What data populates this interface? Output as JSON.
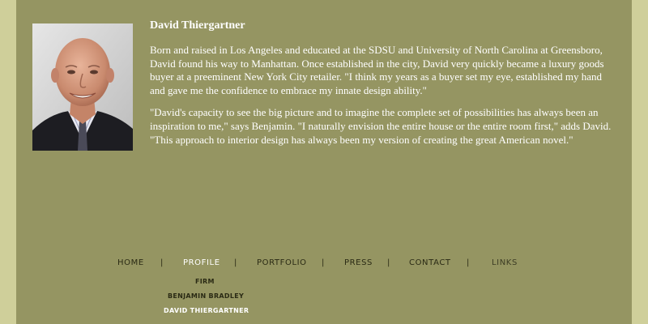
{
  "bio": {
    "name": "David Thiergartner",
    "paragraphs": [
      "Born and raised in Los Angeles and educated at the SDSU and University of North Carolina at Greensboro, David found his way to Manhattan. Once established in the city, David very quickly became a luxury goods buyer at a preeminent New York City retailer. \"I think my years as a buyer set my eye, established my hand and gave me the confidence to embrace my innate design ability.\"",
      "\"David's capacity to see the big picture and to imagine the complete set of possibilities has always been an inspiration to me,\" says Benjamin. \"I naturally envision the entire house or the entire room first,\" adds David. \"This approach to interior design has always been my version of creating the great American novel.\""
    ]
  },
  "nav": {
    "home": "HOME",
    "profile": "PROFILE",
    "portfolio": "PORTFOLIO",
    "press": "PRESS",
    "contact": "CONTACT",
    "links": "LINKS",
    "separator": "|"
  },
  "subnav": {
    "firm": "FIRM",
    "benjamin": "BENJAMIN BRADLEY",
    "david": "DAVID THIERGARTNER"
  },
  "colors": {
    "page_background": "#cfcf9a",
    "panel": "#959562",
    "text": "#ffffff",
    "nav_text": "#2a2a14"
  }
}
